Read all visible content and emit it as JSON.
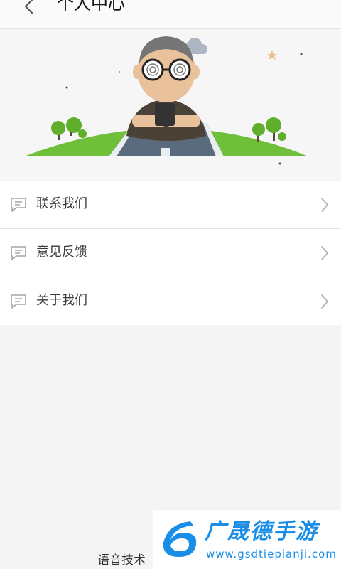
{
  "header": {
    "title": "个人中心",
    "back_icon": "chevron-left-icon"
  },
  "menu": {
    "items": [
      {
        "label": "联系我们",
        "icon": "message-icon"
      },
      {
        "label": "意见反馈",
        "icon": "message-icon"
      },
      {
        "label": "关于我们",
        "icon": "message-icon"
      }
    ]
  },
  "footer": {
    "text": "语音技术"
  },
  "watermark": {
    "name": "广晟德手游",
    "url": "www.gsdtiepianji.com"
  },
  "colors": {
    "background": "#f4f4f4",
    "grass": "#6fbf3a",
    "road": "#5a6b7d",
    "watermark": "#1a8ee6"
  }
}
